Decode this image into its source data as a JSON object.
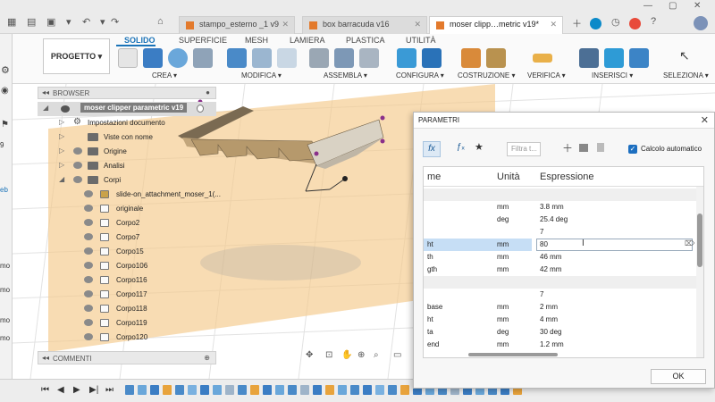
{
  "tabs": [
    {
      "label": "stampo_esterno _1 v9",
      "active": false
    },
    {
      "label": "box barracuda v16",
      "active": false
    },
    {
      "label": "moser clipp…metric v19*",
      "active": true
    }
  ],
  "ribbon": {
    "project_label": "PROGETTO",
    "tabs": [
      "SOLIDO",
      "SUPERFICIE",
      "MESH",
      "LAMIERA",
      "PLASTICA",
      "UTILITÀ"
    ],
    "groups": [
      "CREA",
      "MODIFICA",
      "ASSEMBLA",
      "CONFIGURA",
      "COSTRUZIONE",
      "VERIFICA",
      "INSERISCI",
      "SELEZIONA"
    ]
  },
  "left_strip": [
    "9",
    "eb",
    "mo",
    "mo",
    "mo",
    "mo"
  ],
  "browser": {
    "header": "BROWSER",
    "root": "moser clipper parametric v19",
    "items": [
      {
        "label": "Impostazioni documento",
        "type": "gear"
      },
      {
        "label": "Viste con nome",
        "type": "folder"
      },
      {
        "label": "Origine",
        "type": "folder"
      },
      {
        "label": "Analisi",
        "type": "folder"
      },
      {
        "label": "Corpi",
        "type": "folder"
      },
      {
        "label": "slide-on_attachment_moser_1(...",
        "type": "body-special"
      },
      {
        "label": "originale",
        "type": "body"
      },
      {
        "label": "Corpo2",
        "type": "body"
      },
      {
        "label": "Corpo7",
        "type": "body"
      },
      {
        "label": "Corpo15",
        "type": "body"
      },
      {
        "label": "Corpo106",
        "type": "body"
      },
      {
        "label": "Corpo116",
        "type": "body"
      },
      {
        "label": "Corpo117",
        "type": "body"
      },
      {
        "label": "Corpo118",
        "type": "body"
      },
      {
        "label": "Corpo119",
        "type": "body"
      },
      {
        "label": "Corpo120",
        "type": "body"
      }
    ]
  },
  "comments_label": "COMMENTI",
  "dialog": {
    "title": "PARAMETRI",
    "filter_placeholder": "Filtra t...",
    "auto_calc_label": "Calcolo automatico",
    "auto_calc_checked": true,
    "columns": [
      "me",
      "Unità",
      "Espressione"
    ],
    "rows": [
      {
        "name": "",
        "unit": "",
        "expr": "",
        "style": "grey"
      },
      {
        "name": "",
        "unit": "mm",
        "expr": "3.8 mm",
        "style": "normal"
      },
      {
        "name": "",
        "unit": "deg",
        "expr": "25.4 deg",
        "style": "normal"
      },
      {
        "name": "",
        "unit": "",
        "expr": "7",
        "style": "normal"
      },
      {
        "name": "ht",
        "unit": "mm",
        "expr": "80",
        "style": "selected"
      },
      {
        "name": "th",
        "unit": "mm",
        "expr": "46 mm",
        "style": "normal"
      },
      {
        "name": "gth",
        "unit": "mm",
        "expr": "42 mm",
        "style": "normal"
      },
      {
        "name": "",
        "unit": "",
        "expr": "",
        "style": "grey"
      },
      {
        "name": "",
        "unit": "",
        "expr": "7",
        "style": "normal"
      },
      {
        "name": "base",
        "unit": "mm",
        "expr": "2 mm",
        "style": "normal"
      },
      {
        "name": "ht",
        "unit": "mm",
        "expr": "4 mm",
        "style": "normal"
      },
      {
        "name": "ta",
        "unit": "deg",
        "expr": "30 deg",
        "style": "normal"
      },
      {
        "name": "end",
        "unit": "mm",
        "expr": "1.2 mm",
        "style": "normal"
      }
    ],
    "ok_label": "OK"
  },
  "colors": {
    "accent": "#1a73b8",
    "plane": "#f2c98a",
    "model": "#b89a6a"
  }
}
